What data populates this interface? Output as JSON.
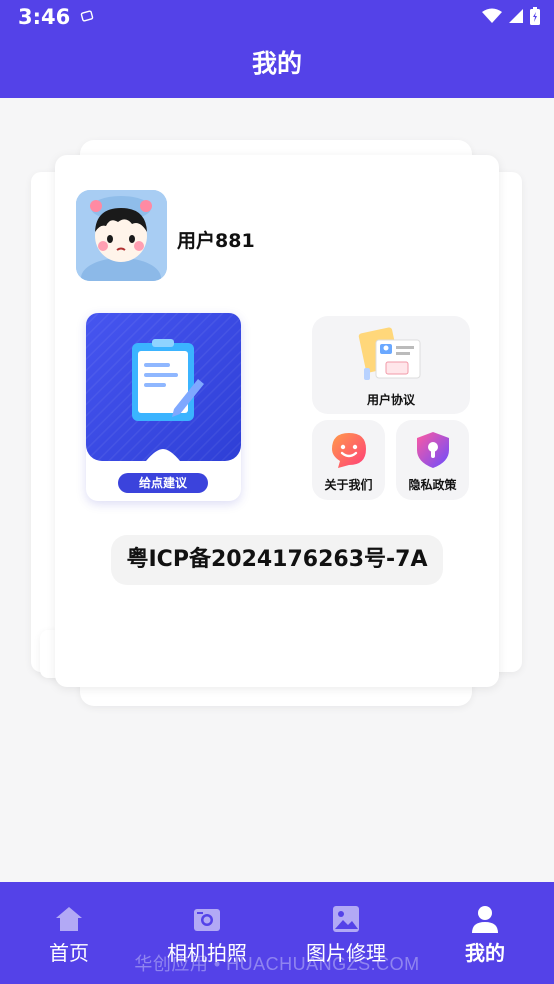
{
  "status_bar": {
    "time": "3:46"
  },
  "header": {
    "title": "我的"
  },
  "profile": {
    "username": "用户881"
  },
  "feedback": {
    "button_label": "给点建议"
  },
  "tiles": {
    "user_agreement": "用户协议",
    "about_us": "关于我们",
    "privacy_policy": "隐私政策"
  },
  "icp": {
    "text": "粤ICP备2024176263号-7A"
  },
  "bottom_nav": {
    "items": [
      {
        "label": "首页",
        "icon": "home-icon"
      },
      {
        "label": "相机拍照",
        "icon": "camera-icon"
      },
      {
        "label": "图片修理",
        "icon": "image-icon"
      },
      {
        "label": "我的",
        "icon": "person-icon"
      }
    ]
  },
  "watermark": {
    "text": "华创应用 • HUACHUANGZS.COM"
  },
  "colors": {
    "brand": "#5442e8",
    "feedback_blue": "#3b43dc"
  }
}
